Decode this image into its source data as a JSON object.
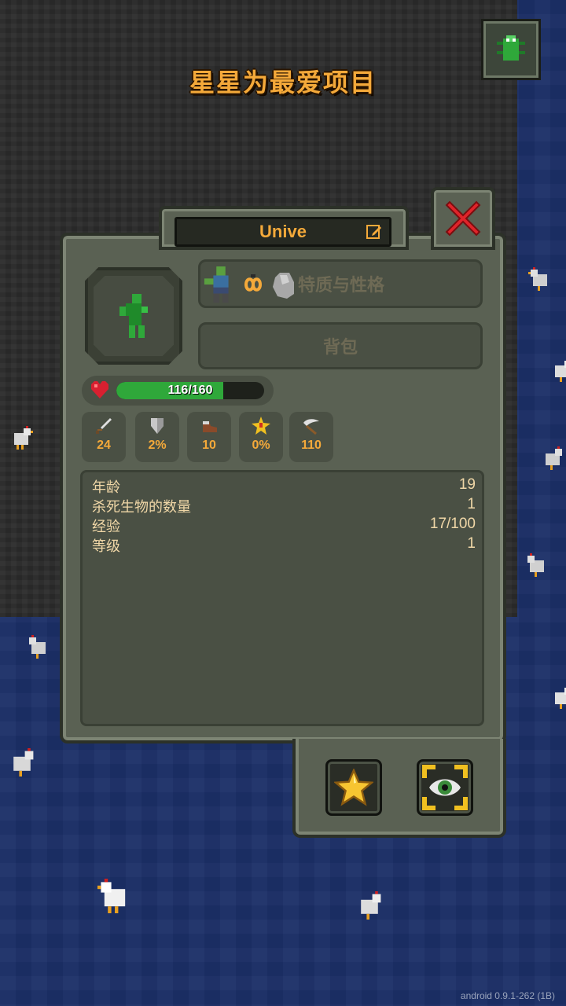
{
  "header": {
    "hint": "星星为最爱项目"
  },
  "unit": {
    "name": "Unive",
    "traits_label": "特质与性格",
    "backpack_label": "背包",
    "health": {
      "text": "116/160",
      "current": 116,
      "max": 160
    },
    "stats": [
      {
        "icon": "sword-icon",
        "value": "24"
      },
      {
        "icon": "shield-icon",
        "value": "2%"
      },
      {
        "icon": "boot-icon",
        "value": "10"
      },
      {
        "icon": "critical-star-icon",
        "value": "0%"
      },
      {
        "icon": "scythe-icon",
        "value": "110"
      }
    ],
    "info": [
      {
        "label": "年龄",
        "value": "19"
      },
      {
        "label": "杀死生物的数量",
        "value": "1"
      },
      {
        "label": "经验",
        "value": "17/100"
      },
      {
        "label": "等级",
        "value": "1"
      }
    ]
  },
  "footer": {
    "version": "android 0.9.1-262 (1B)"
  },
  "colors": {
    "accent": "#f4a93a",
    "panel": "#5a6153",
    "health": "#2fa83a",
    "close": "#e0242a"
  }
}
